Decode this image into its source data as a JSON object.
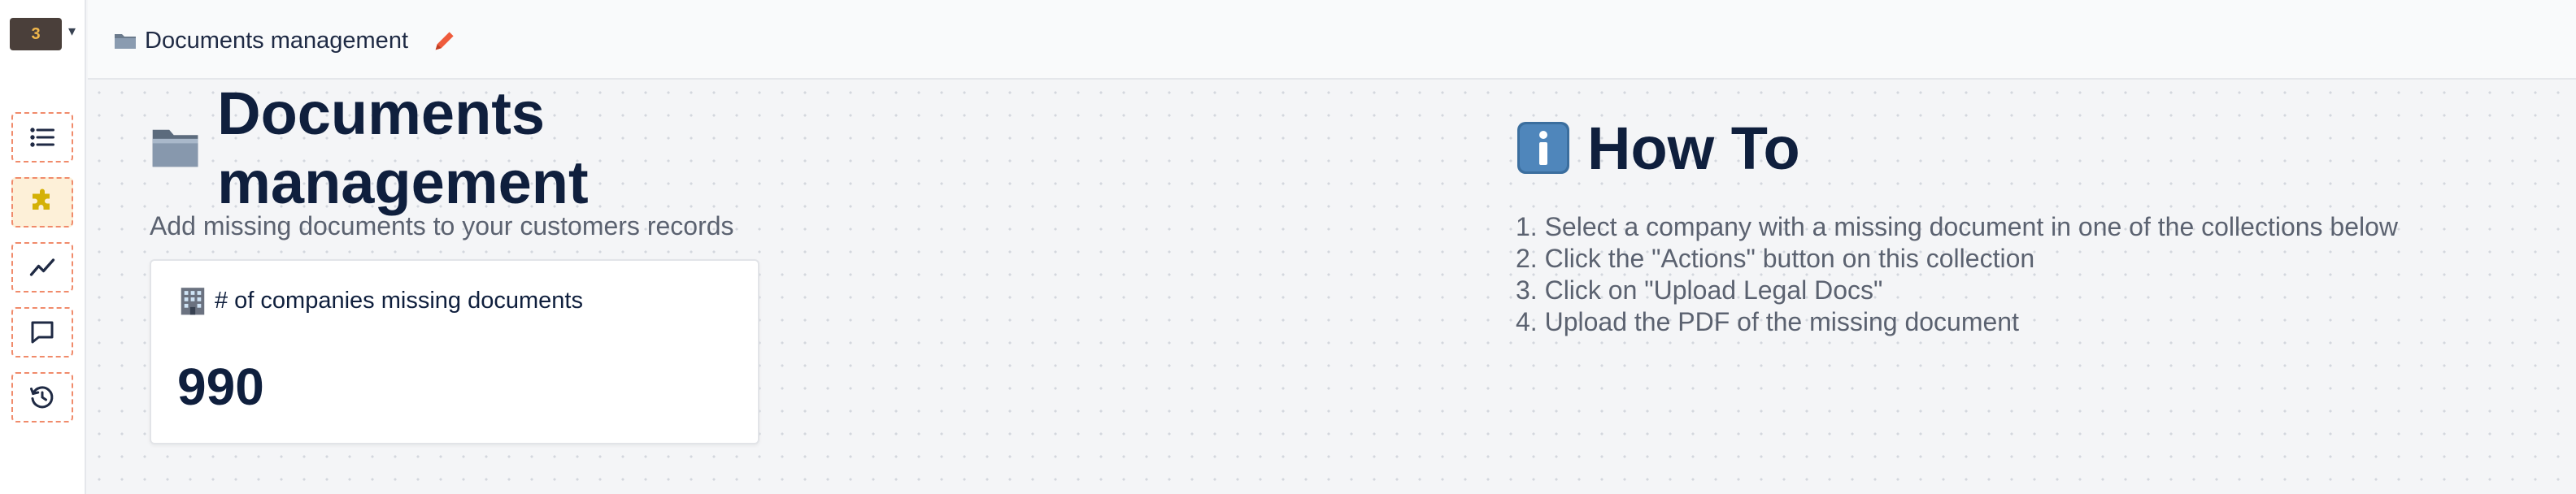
{
  "brand": {
    "mark": "3"
  },
  "header": {
    "breadcrumb": "Documents management"
  },
  "main": {
    "title": "Documents management",
    "subtitle": "Add missing documents to your customers records",
    "card": {
      "title": "# of companies missing documents",
      "value": "990"
    }
  },
  "howto": {
    "title": "How To",
    "steps": [
      "1. Select a company with a missing document in one of the collections below",
      "2. Click the \"Actions\" button on this collection",
      "3. Click on \"Upload Legal Docs\"",
      "4. Upload the PDF of the missing document"
    ]
  },
  "sidebar": {
    "items": [
      {
        "icon": "list-icon",
        "active": false
      },
      {
        "icon": "puzzle-icon",
        "active": true
      },
      {
        "icon": "chart-line-icon",
        "active": false
      },
      {
        "icon": "message-icon",
        "active": false
      },
      {
        "icon": "history-icon",
        "active": false
      }
    ]
  },
  "colors": {
    "accent_border": "#f08b6b",
    "active_bg": "#fdf0d8",
    "heading": "#0f1f3d",
    "edit_icon": "#ef5b3c"
  }
}
